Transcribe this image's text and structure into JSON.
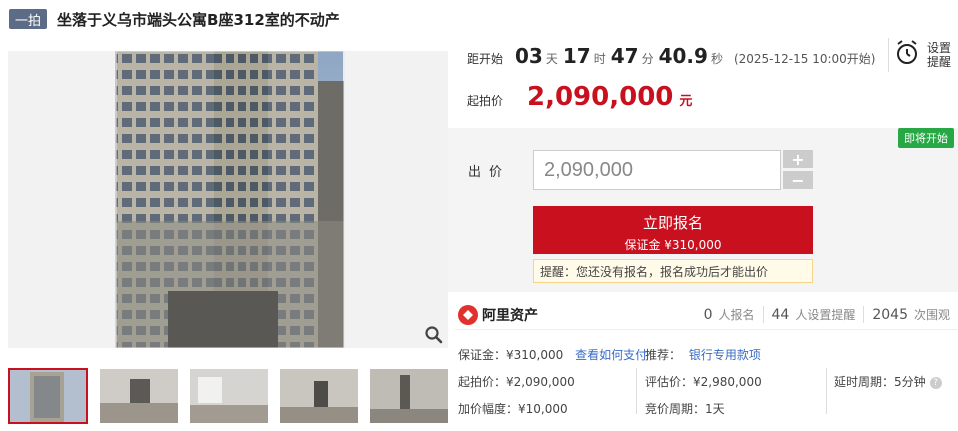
{
  "header": {
    "badge": "一拍",
    "title": "坐落于义乌市端头公寓B座312室的不动产"
  },
  "countdown": {
    "label": "距开始",
    "days": "03",
    "days_unit": "天",
    "hours": "17",
    "hours_unit": "时",
    "minutes": "47",
    "minutes_unit": "分",
    "seconds": "40.9",
    "seconds_unit": "秒",
    "start_text": "(2025-12-15 10:00开始)"
  },
  "reminder_button": {
    "line1": "设置",
    "line2": "提醒"
  },
  "start_price": {
    "label": "起拍价",
    "value": "2,090,000",
    "unit": "元"
  },
  "bid": {
    "status_tag": "即将开始",
    "label": "出价",
    "input_value": "2,090,000",
    "plus": "+",
    "minus": "−",
    "register_label": "立即报名",
    "deposit_label": "保证金 ¥310,000",
    "tip": "提醒：您还没有报名，报名成功后才能出价"
  },
  "platform": {
    "name": "阿里资产"
  },
  "stats": [
    {
      "num": "0",
      "label": "人报名"
    },
    {
      "num": "44",
      "label": "人设置提醒"
    },
    {
      "num": "2045",
      "label": "次围观"
    }
  ],
  "details": {
    "deposit": "保证金：¥310,000",
    "deposit_link": "查看如何支付",
    "recommend_label": "推荐：",
    "recommend_link": "银行专用款项",
    "start_price": "起拍价：¥2,090,000",
    "valuation": "评估价：¥2,980,000",
    "delay_period": "延时周期：5分钟",
    "increment": "加价幅度：¥10,000",
    "bid_period": "竞价周期：1天"
  },
  "colors": {
    "accent": "#c8101e",
    "badge": "#5c6b86",
    "status_green": "#28a745",
    "link": "#3a6cc6"
  }
}
